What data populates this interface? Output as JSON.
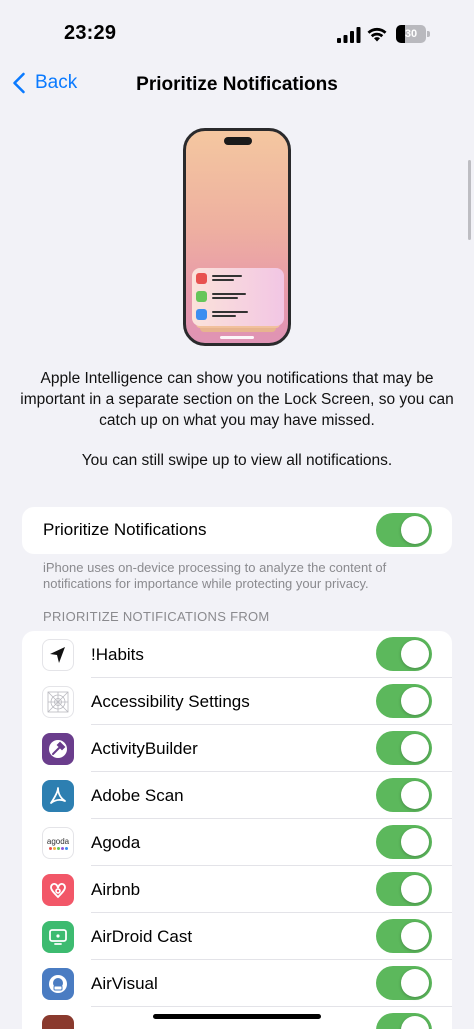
{
  "status_bar": {
    "time": "23:29",
    "battery": "30",
    "battery_level": 0.3
  },
  "nav": {
    "back_label": "Back",
    "title": "Prioritize Notifications"
  },
  "description": {
    "paragraph1": "Apple Intelligence can show you notifications that may be important in a separate section on the Lock Screen, so you can catch up on what you may have missed.",
    "paragraph2": "You can still swipe up to view all notifications."
  },
  "main_toggle": {
    "label": "Prioritize Notifications",
    "on": true
  },
  "footnote": "iPhone uses on-device processing to analyze the content of notifications for importance while protecting your privacy.",
  "section_header": "PRIORITIZE NOTIFICATIONS FROM",
  "apps": [
    {
      "label": "!Habits",
      "icon": "habits-icon",
      "on": true
    },
    {
      "label": "Accessibility Settings",
      "icon": "accessibility-settings-icon",
      "on": true
    },
    {
      "label": "ActivityBuilder",
      "icon": "activitybuilder-icon",
      "on": true
    },
    {
      "label": "Adobe Scan",
      "icon": "adobe-scan-icon",
      "on": true
    },
    {
      "label": "Agoda",
      "icon": "agoda-icon",
      "agoda_text": "agoda",
      "on": true
    },
    {
      "label": "Airbnb",
      "icon": "airbnb-icon",
      "on": true
    },
    {
      "label": "AirDroid Cast",
      "icon": "airdroid-cast-icon",
      "on": true
    },
    {
      "label": "AirVisual",
      "icon": "airvisual-icon",
      "on": true
    }
  ],
  "colors": {
    "accent": "#0a7aff",
    "toggle_on": "#5cb85c",
    "background": "#f2f2f7"
  }
}
